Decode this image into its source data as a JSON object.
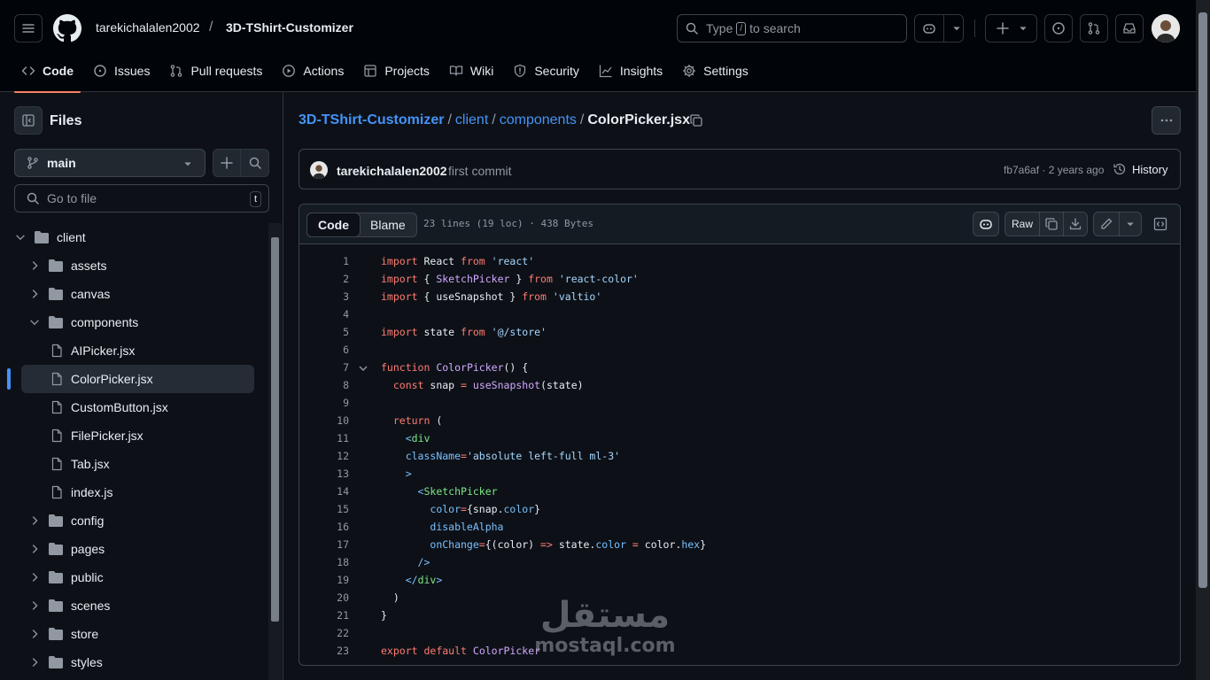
{
  "header": {
    "owner": "tarekichalalen2002",
    "separator": "/",
    "repo": "3D-TShirt-Customizer",
    "search": {
      "prefix": "Type",
      "key": "/",
      "suffix": "to search"
    }
  },
  "tabs": [
    {
      "label": "Code",
      "icon": "code-icon",
      "active": true
    },
    {
      "label": "Issues",
      "icon": "issue-icon"
    },
    {
      "label": "Pull requests",
      "icon": "pull-request-icon"
    },
    {
      "label": "Actions",
      "icon": "play-icon"
    },
    {
      "label": "Projects",
      "icon": "table-icon"
    },
    {
      "label": "Wiki",
      "icon": "book-icon"
    },
    {
      "label": "Security",
      "icon": "shield-icon"
    },
    {
      "label": "Insights",
      "icon": "graph-icon"
    },
    {
      "label": "Settings",
      "icon": "gear-icon"
    }
  ],
  "sidebar": {
    "title": "Files",
    "branch": "main",
    "goto_placeholder": "Go to file",
    "goto_shortcut": "t",
    "tree": [
      {
        "label": "client",
        "type": "dir",
        "open": true,
        "depth": 0
      },
      {
        "label": "assets",
        "type": "dir",
        "open": false,
        "depth": 1
      },
      {
        "label": "canvas",
        "type": "dir",
        "open": false,
        "depth": 1
      },
      {
        "label": "components",
        "type": "dir",
        "open": true,
        "depth": 1
      },
      {
        "label": "AIPicker.jsx",
        "type": "file",
        "depth": 2
      },
      {
        "label": "ColorPicker.jsx",
        "type": "file",
        "depth": 2,
        "selected": true
      },
      {
        "label": "CustomButton.jsx",
        "type": "file",
        "depth": 2
      },
      {
        "label": "FilePicker.jsx",
        "type": "file",
        "depth": 2
      },
      {
        "label": "Tab.jsx",
        "type": "file",
        "depth": 2
      },
      {
        "label": "index.js",
        "type": "file",
        "depth": 2
      },
      {
        "label": "config",
        "type": "dir",
        "open": false,
        "depth": 1
      },
      {
        "label": "pages",
        "type": "dir",
        "open": false,
        "depth": 1
      },
      {
        "label": "public",
        "type": "dir",
        "open": false,
        "depth": 1
      },
      {
        "label": "scenes",
        "type": "dir",
        "open": false,
        "depth": 1
      },
      {
        "label": "store",
        "type": "dir",
        "open": false,
        "depth": 1
      },
      {
        "label": "styles",
        "type": "dir",
        "open": false,
        "depth": 1
      }
    ]
  },
  "breadcrumb": {
    "repo": "3D-TShirt-Customizer",
    "dir1": "client",
    "dir2": "components",
    "file": "ColorPicker.jsx"
  },
  "commit": {
    "author": "tarekichalalen2002",
    "message": "first commit",
    "meta": "fb7a6af · 2 years ago",
    "history": "History"
  },
  "viewer": {
    "tab_code": "Code",
    "tab_blame": "Blame",
    "info": "23 lines (19 loc) · 438 Bytes",
    "raw": "Raw"
  },
  "code_lines": [
    "import React from 'react'",
    "import { SketchPicker } from 'react-color'",
    "import { useSnapshot } from 'valtio'",
    "",
    "import state from '@/store'",
    "",
    "function ColorPicker() {",
    "  const snap = useSnapshot(state)",
    "",
    "  return (",
    "    <div",
    "    className='absolute left-full ml-3'",
    "    >",
    "      <SketchPicker",
    "        color={snap.color}",
    "        disableAlpha",
    "        onChange={(color) => state.color = color.hex}",
    "      />",
    "    </div>",
    "  )",
    "}",
    "",
    "export default ColorPicker"
  ],
  "watermark": {
    "arabic": "مستقل",
    "latin": "mostaql.com"
  }
}
